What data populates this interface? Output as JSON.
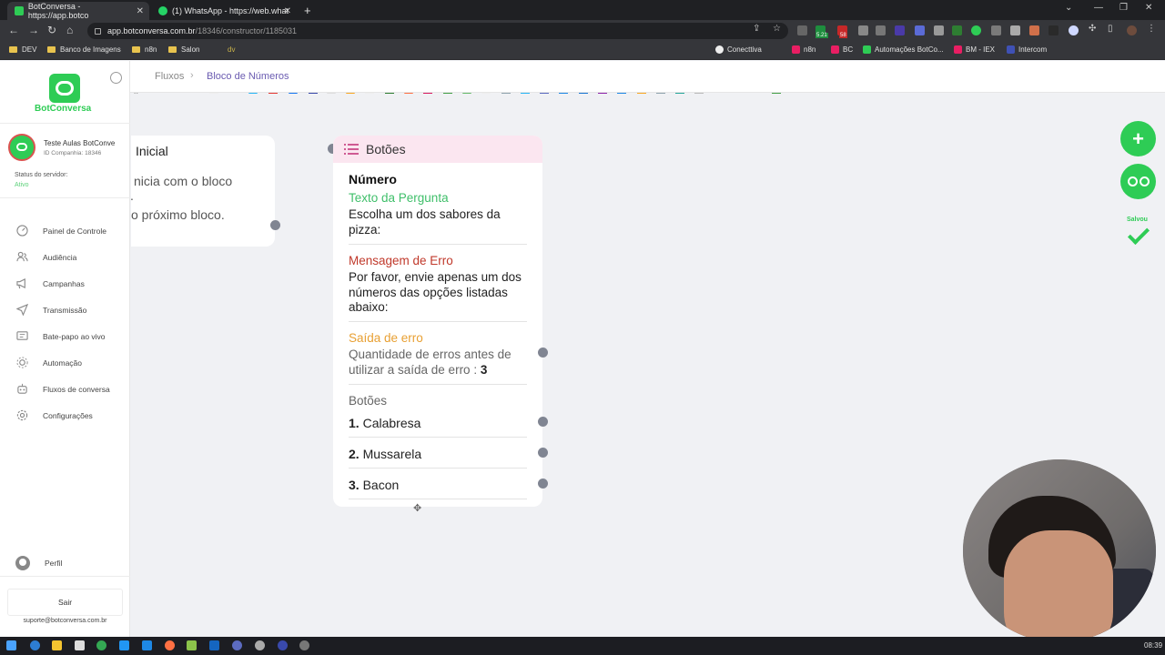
{
  "browser": {
    "tabs": [
      {
        "label": "BotConversa - https://app.botco",
        "close": "✕"
      },
      {
        "label": "(1) WhatsApp - https://web.what",
        "close": "✕"
      }
    ],
    "new_tab": "+",
    "url_host": "app.botconversa.com.br",
    "url_path": "/18346/constructor/1185031",
    "extension_badges": [
      "5.21",
      "58"
    ],
    "bookmarks": [
      "DEV",
      "Banco de Imagens",
      "n8n",
      "Salon",
      "dv",
      "Conecttiva",
      "n8n",
      "BC",
      "Automações BotCo...",
      "BM - IEX",
      "Intercom"
    ]
  },
  "sidebar": {
    "logo_text": "BotConversa",
    "company_name": "Teste Aulas BotConve",
    "company_id": "ID Companhia: 18346",
    "status_label": "Status do servidor:",
    "status_value": "Ativo",
    "items": [
      {
        "label": "Painel de Controle",
        "icon": "dashboard-icon"
      },
      {
        "label": "Audiência",
        "icon": "users-icon"
      },
      {
        "label": "Campanhas",
        "icon": "megaphone-icon"
      },
      {
        "label": "Transmissão",
        "icon": "send-icon"
      },
      {
        "label": "Bate-papo ao vivo",
        "icon": "chat-icon"
      },
      {
        "label": "Automação",
        "icon": "automation-icon"
      },
      {
        "label": "Fluxos de conversa",
        "icon": "robot-icon"
      },
      {
        "label": "Configurações",
        "icon": "gear-icon"
      }
    ],
    "profile_label": "Perfil",
    "logout_label": "Sair",
    "support_email": "suporte@botconversa.com.br"
  },
  "breadcrumb": {
    "parent": "Fluxos",
    "current": "Bloco de Números"
  },
  "start_block": {
    "title": "Inicial",
    "lines": [
      "nicia com o bloco",
      ".",
      "o próximo bloco."
    ]
  },
  "buttons_block": {
    "title": "Botões",
    "type_label": "Número",
    "question_label": "Texto da Pergunta",
    "question_text": "Escolha um dos sabores da pizza:",
    "error_label": "Mensagem de Erro",
    "error_text": "Por favor, envie apenas um dos números das opções listadas abaixo:",
    "error_exit_label": "Saída de erro",
    "error_exit_text": "Quantidade de erros antes de utilizar a saída de erro : ",
    "error_exit_count": "3",
    "buttons_label": "Botões",
    "options": [
      {
        "number": "1.",
        "label": "Calabresa"
      },
      {
        "number": "2.",
        "label": "Mussarela"
      },
      {
        "number": "3.",
        "label": "Bacon"
      }
    ]
  },
  "actions": {
    "add": "+",
    "saved_label": "Salvou"
  },
  "taskbar": {
    "clock": "08:39"
  },
  "colors": {
    "brand_green": "#2ecc55",
    "breadcrumb_purple": "#6a5bb1",
    "question_green": "#3fbf6a",
    "error_red": "#c0392b",
    "error_exit_orange": "#e8a033",
    "block_header_pink": "#fbe6f0"
  }
}
